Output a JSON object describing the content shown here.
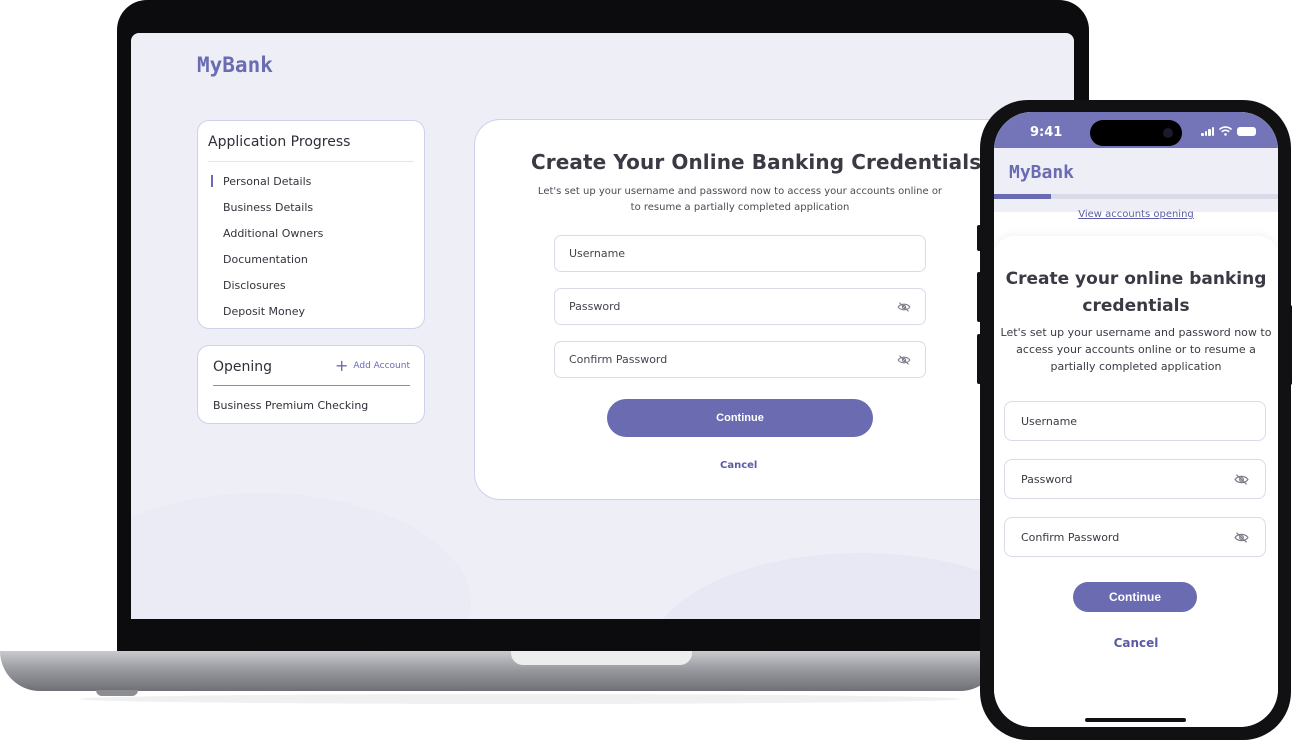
{
  "desktop": {
    "brand": "MyBank",
    "progress": {
      "title": "Application Progress",
      "items": [
        {
          "label": "Personal Details",
          "active": true
        },
        {
          "label": "Business Details",
          "active": false
        },
        {
          "label": "Additional Owners",
          "active": false
        },
        {
          "label": "Documentation",
          "active": false
        },
        {
          "label": "Disclosures",
          "active": false
        },
        {
          "label": "Deposit Money",
          "active": false
        }
      ]
    },
    "opening": {
      "title": "Opening",
      "add_label": "Add Account",
      "item": "Business Premium Checking"
    },
    "credentials": {
      "title": "Create Your Online Banking Credentials",
      "subtitle": "Let's set up your username and password now to access your accounts online or to resume a partially completed application",
      "username_placeholder": "Username",
      "password_placeholder": "Password",
      "confirm_placeholder": "Confirm Password",
      "continue_label": "Continue",
      "cancel_label": "Cancel"
    }
  },
  "mobile": {
    "time": "9:41",
    "brand": "MyBank",
    "progress_fraction": 0.2,
    "view_link": "View accounts opening",
    "credentials": {
      "title": "Create your online banking credentials",
      "subtitle": "Let's set up your username and password now to access your accounts online or to resume a partially completed application",
      "username_placeholder": "Username",
      "password_placeholder": "Password",
      "confirm_placeholder": "Confirm Password",
      "continue_label": "Continue",
      "cancel_label": "Cancel"
    }
  },
  "colors": {
    "accent": "#6a6bb1",
    "status_bar": "#7475b8",
    "background": "#eeeff6"
  },
  "icons": {
    "password_toggle": "eye-off-icon",
    "add": "plus-icon"
  }
}
